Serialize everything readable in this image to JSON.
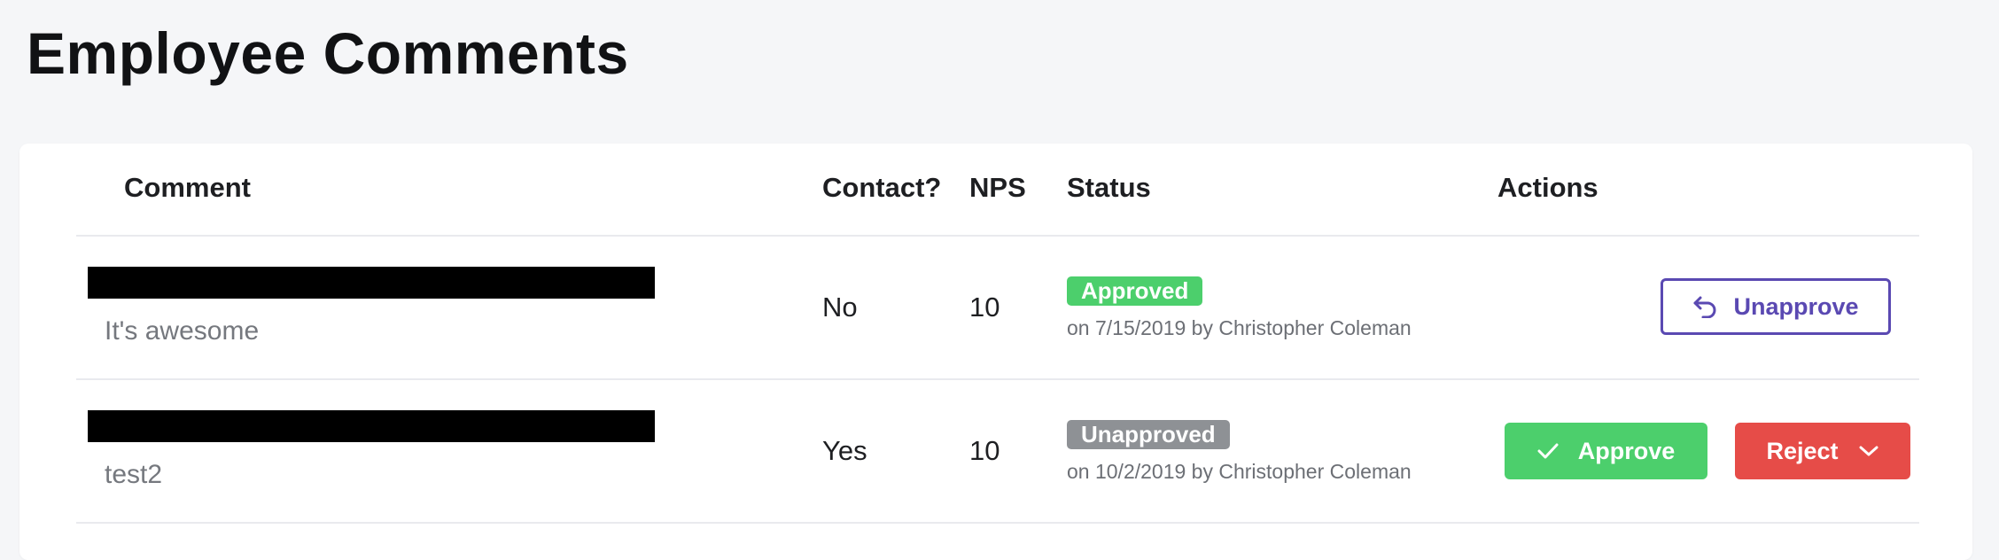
{
  "page": {
    "title": "Employee Comments"
  },
  "table": {
    "columns": {
      "comment": "Comment",
      "contact": "Contact?",
      "nps": "NPS",
      "status": "Status",
      "actions": "Actions"
    },
    "rows": [
      {
        "comment": "It's awesome",
        "contact": "No",
        "nps": "10",
        "status_label": "Approved",
        "status_meta": "on 7/15/2019 by Christopher Coleman",
        "actions": {
          "unapprove_label": "Unapprove"
        }
      },
      {
        "comment": "test2",
        "contact": "Yes",
        "nps": "10",
        "status_label": "Unapproved",
        "status_meta": "on 10/2/2019 by Christopher Coleman",
        "actions": {
          "approve_label": "Approve",
          "reject_label": "Reject"
        }
      }
    ]
  },
  "icons": {
    "unapprove": "undo-arrow-icon",
    "approve": "check-icon",
    "reject_menu": "chevron-down-icon"
  },
  "colors": {
    "approved": "#4ccf6c",
    "unapproved": "#8e9195",
    "unapprove_accent": "#5a49b2",
    "reject": "#e64c48",
    "page_bg": "#f5f6f8"
  }
}
